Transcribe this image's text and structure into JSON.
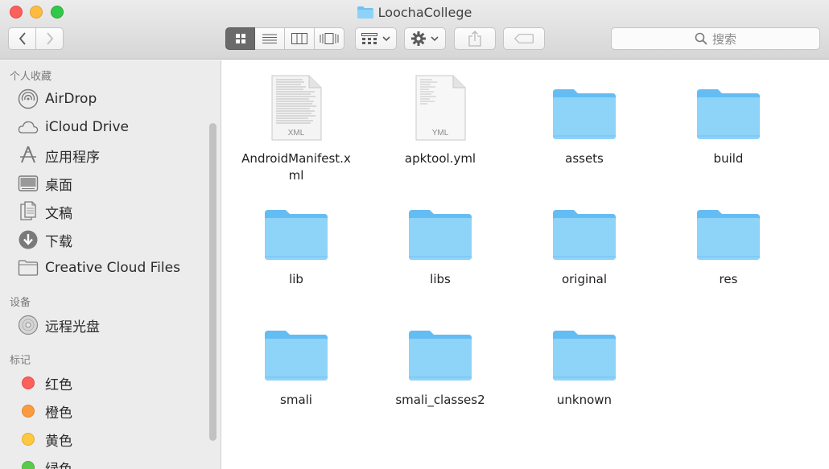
{
  "window": {
    "title": "LoochaCollege"
  },
  "toolbar": {
    "back": "back",
    "forward": "forward",
    "views": [
      "icon-view",
      "list-view",
      "column-view",
      "cover-flow-view"
    ],
    "search_placeholder": "搜索"
  },
  "sidebar": {
    "favorites_title": "个人收藏",
    "favorites": [
      {
        "label": "AirDrop",
        "icon": "airdrop-icon"
      },
      {
        "label": "iCloud Drive",
        "icon": "icloud-icon"
      },
      {
        "label": "应用程序",
        "icon": "applications-icon"
      },
      {
        "label": "桌面",
        "icon": "desktop-icon"
      },
      {
        "label": "文稿",
        "icon": "documents-icon"
      },
      {
        "label": "下载",
        "icon": "downloads-icon"
      },
      {
        "label": "Creative Cloud Files",
        "icon": "folder-icon"
      }
    ],
    "devices_title": "设备",
    "devices": [
      {
        "label": "远程光盘",
        "icon": "disc-icon"
      }
    ],
    "tags_title": "标记",
    "tags": [
      {
        "label": "红色",
        "color": "#fc605c"
      },
      {
        "label": "橙色",
        "color": "#fd9a3e"
      },
      {
        "label": "黄色",
        "color": "#fdc840"
      },
      {
        "label": "绿色",
        "color": "#58cc4a"
      }
    ]
  },
  "files": [
    {
      "name": "AndroidManifest.xml",
      "type": "XML"
    },
    {
      "name": "apktool.yml",
      "type": "YML"
    },
    {
      "name": "assets",
      "type": "folder"
    },
    {
      "name": "build",
      "type": "folder"
    },
    {
      "name": "lib",
      "type": "folder"
    },
    {
      "name": "libs",
      "type": "folder"
    },
    {
      "name": "original",
      "type": "folder"
    },
    {
      "name": "res",
      "type": "folder"
    },
    {
      "name": "smali",
      "type": "folder"
    },
    {
      "name": "smali_classes2",
      "type": "folder"
    },
    {
      "name": "unknown",
      "type": "folder"
    }
  ],
  "file_labels": {
    "manifest_line1": "AndroidManifest.x",
    "manifest_line2": "ml"
  }
}
